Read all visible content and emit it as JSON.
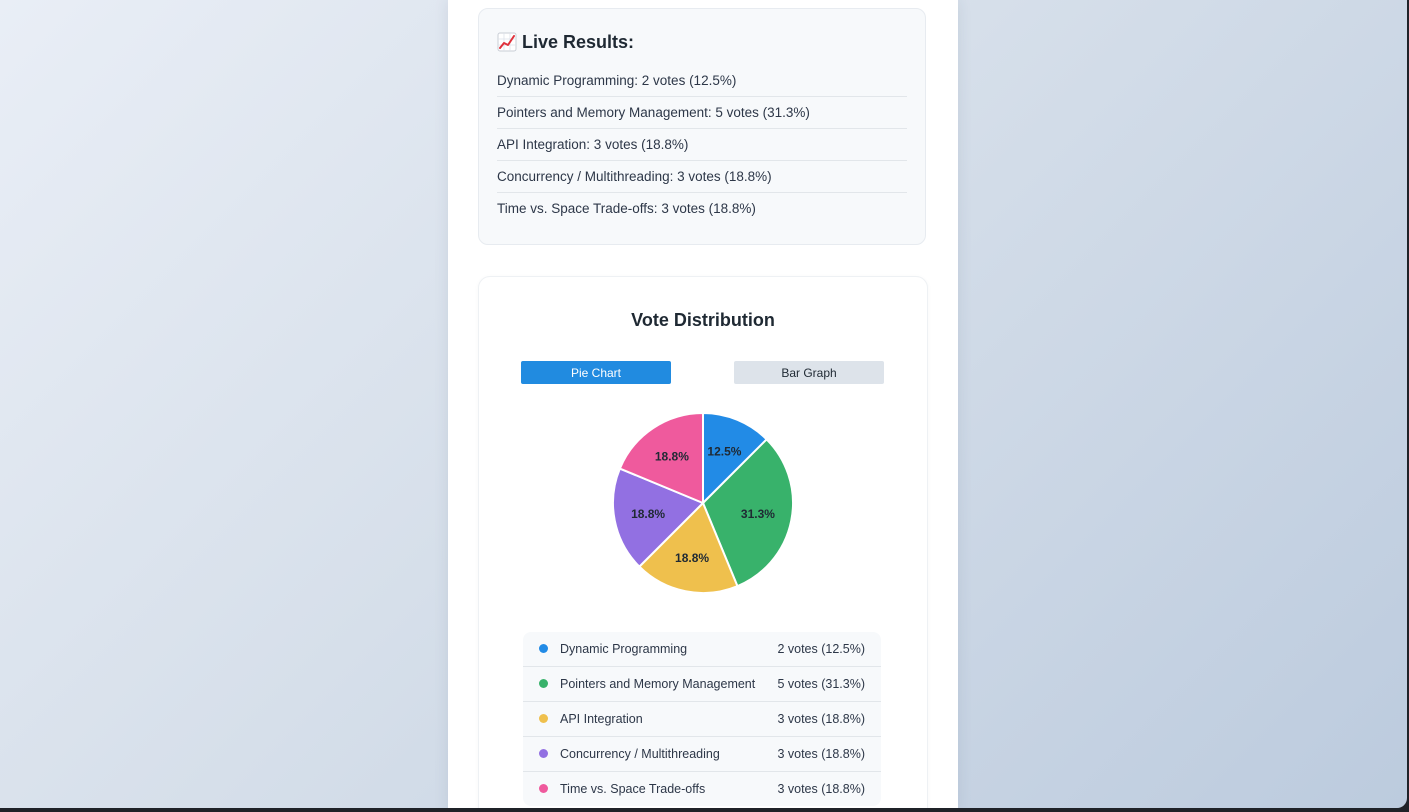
{
  "results": {
    "title": "Live Results:",
    "items": [
      "Dynamic Programming: 2 votes (12.5%)",
      "Pointers and Memory Management: 5 votes (31.3%)",
      "API Integration: 3 votes (18.8%)",
      "Concurrency / Multithreading: 3 votes (18.8%)",
      "Time vs. Space Trade-offs: 3 votes (18.8%)"
    ]
  },
  "distribution": {
    "title": "Vote Distribution",
    "pie_button": "Pie Chart",
    "bar_button": "Bar Graph",
    "active_view": "Pie Chart"
  },
  "legend": [
    {
      "label": "Dynamic Programming",
      "votes": "2 votes (12.5%)"
    },
    {
      "label": "Pointers and Memory Management",
      "votes": "5 votes (31.3%)"
    },
    {
      "label": "API Integration",
      "votes": "3 votes (18.8%)"
    },
    {
      "label": "Concurrency / Multithreading",
      "votes": "3 votes (18.8%)"
    },
    {
      "label": "Time vs. Space Trade-offs",
      "votes": "3 votes (18.8%)"
    }
  ],
  "colors": {
    "accent": "#218be0",
    "series": [
      "#228be6",
      "#38b26b",
      "#efc04d",
      "#9270e2",
      "#ef5a9d"
    ]
  },
  "chart_data": {
    "type": "pie",
    "categories": [
      "Dynamic Programming",
      "Pointers and Memory Management",
      "API Integration",
      "Concurrency / Multithreading",
      "Time vs. Space Trade-offs"
    ],
    "values": [
      2,
      5,
      3,
      3,
      3
    ],
    "data_labels": [
      "12.5%",
      "31.3%",
      "18.8%",
      "18.8%",
      "18.8%"
    ],
    "title": "Vote Distribution"
  }
}
